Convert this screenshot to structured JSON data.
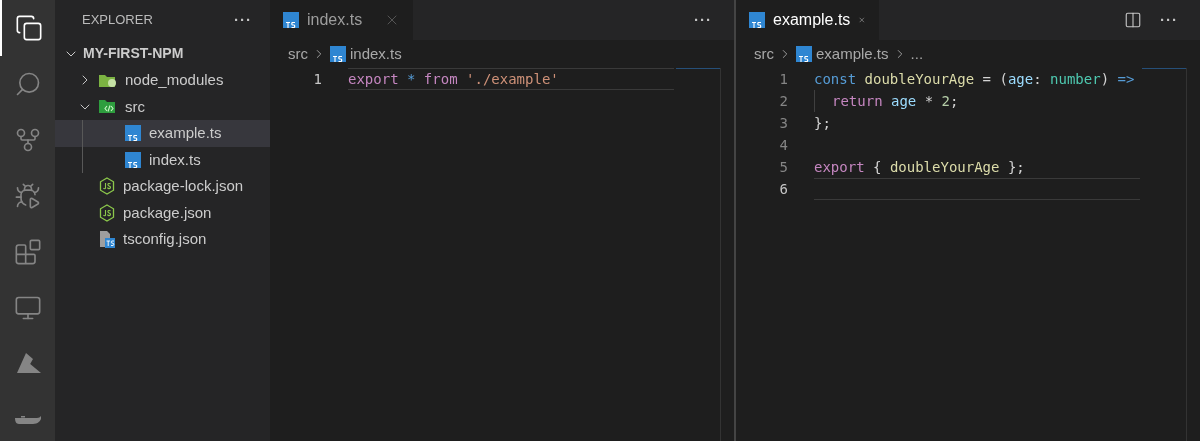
{
  "activity_bar": [
    {
      "kind": "files",
      "selected": true
    },
    {
      "kind": "search",
      "selected": false
    },
    {
      "kind": "source-control",
      "selected": false
    },
    {
      "kind": "run-debug",
      "selected": false
    },
    {
      "kind": "extensions",
      "selected": false
    },
    {
      "kind": "remote",
      "selected": false
    },
    {
      "kind": "azure",
      "selected": false
    },
    {
      "kind": "docker",
      "selected": false
    }
  ],
  "sidebar": {
    "title": "EXPLORER",
    "more": "···",
    "project": {
      "label": "MY-FIRST-NPM",
      "expanded": true
    },
    "items": [
      {
        "label": "node_modules",
        "kind": "folder",
        "expanded": false,
        "selected": false
      },
      {
        "label": "src",
        "kind": "src-folder",
        "expanded": true,
        "selected": false,
        "children": [
          {
            "label": "example.ts",
            "kind": "ts",
            "selected": true
          },
          {
            "label": "index.ts",
            "kind": "ts",
            "selected": false
          }
        ]
      },
      {
        "label": "package-lock.json",
        "kind": "node",
        "selected": false
      },
      {
        "label": "package.json",
        "kind": "node",
        "selected": false
      },
      {
        "label": "tsconfig.json",
        "kind": "tsconfig",
        "selected": false
      }
    ]
  },
  "editor_groups": [
    {
      "tabs": [
        {
          "label": "index.ts",
          "selected": true
        }
      ],
      "more": "···",
      "split": false,
      "breadcrumb": [
        "src",
        "index.ts"
      ],
      "lines": [
        {
          "number": "1",
          "current": true,
          "indented": false,
          "tokens": [
            {
              "text": "export",
              "kind": "control"
            },
            {
              "text": " *",
              "kind": "operator"
            },
            {
              "text": " from",
              "kind": "control"
            },
            {
              "text": " './example'",
              "kind": "string"
            }
          ]
        }
      ]
    },
    {
      "tabs": [
        {
          "label": "example.ts",
          "selected": true
        }
      ],
      "more": "···",
      "split": true,
      "breadcrumb": [
        "src",
        "example.ts",
        "..."
      ],
      "lines": [
        {
          "number": "1",
          "current": false,
          "indented": false,
          "tokens": [
            {
              "text": "const",
              "kind": "keyword"
            },
            {
              "text": " doubleYourAge",
              "kind": "function"
            },
            {
              "text": " = ("
            },
            {
              "text": "age",
              "kind": "param"
            },
            {
              "text": ": "
            },
            {
              "text": "number",
              "kind": "type"
            },
            {
              "text": ")"
            },
            {
              "text": " =>",
              "kind": "keyword"
            }
          ]
        },
        {
          "number": "2",
          "current": false,
          "indented": true,
          "tokens": [
            {
              "text": "return",
              "kind": "control"
            },
            {
              "text": " age",
              "kind": "param"
            },
            {
              "text": " * "
            },
            {
              "text": "2",
              "kind": "number"
            },
            {
              "text": ";"
            }
          ]
        },
        {
          "number": "3",
          "current": false,
          "indented": false,
          "tokens": [
            {
              "text": "};"
            }
          ]
        },
        {
          "number": "4",
          "current": false,
          "indented": false
        },
        {
          "number": "5",
          "current": false,
          "indented": false,
          "tokens": [
            {
              "text": "export",
              "kind": "control"
            },
            {
              "text": " { "
            },
            {
              "text": "doubleYourAge",
              "kind": "function"
            },
            {
              "text": " };"
            }
          ]
        },
        {
          "number": "6",
          "current": true,
          "indented": false
        }
      ]
    }
  ]
}
